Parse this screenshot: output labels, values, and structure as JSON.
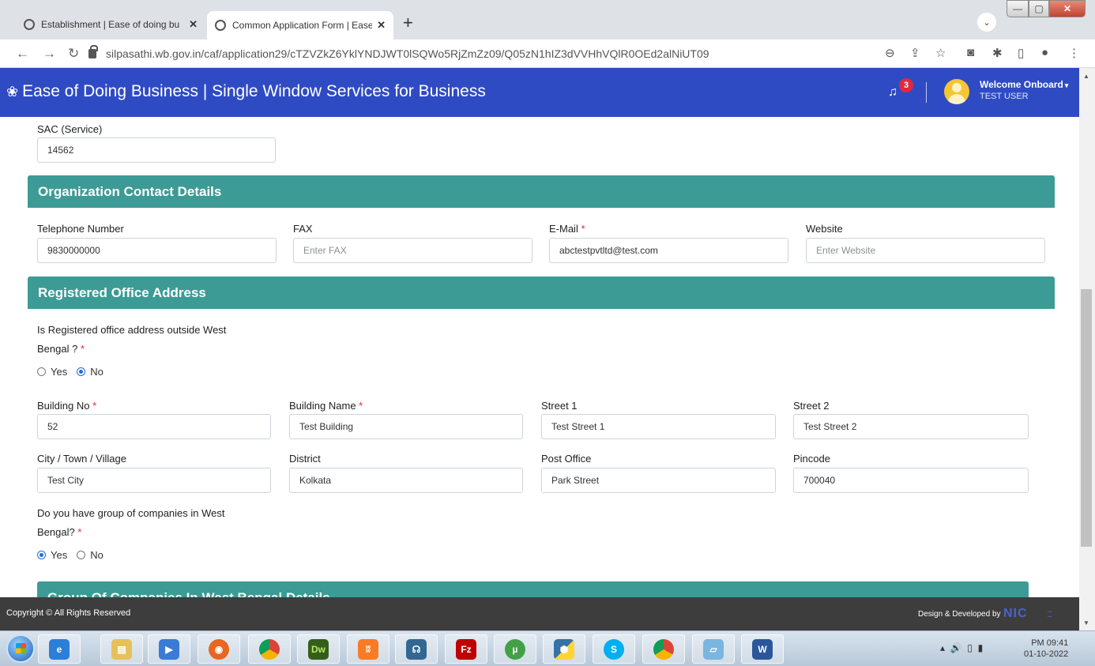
{
  "browser": {
    "tabs": [
      {
        "title": "Establishment | Ease of doing bu",
        "active": false
      },
      {
        "title": "Common Application Form | Ease",
        "active": true
      }
    ],
    "url": "silpasathi.wb.gov.in/caf/application29/cTZVZkZ6YklYNDJWT0lSQWo5RjZmZz09/Q05zN1hIZ3dVVHhVQlR0OEd2alNiUT09"
  },
  "header": {
    "title": "Ease of Doing Business | Single Window Services for Business",
    "notification_count": "3",
    "welcome": "Welcome Onboard",
    "user": "TEST USER"
  },
  "sac": {
    "label": "SAC (Service)",
    "value": "14562"
  },
  "contact": {
    "heading": "Organization Contact Details",
    "telephone_label": "Telephone Number",
    "telephone_value": "9830000000",
    "fax_label": "FAX",
    "fax_placeholder": "Enter FAX",
    "email_label": "E-Mail",
    "email_value": "abctestpvtltd@test.com",
    "website_label": "Website",
    "website_placeholder": "Enter Website"
  },
  "registered": {
    "heading": "Registered Office Address",
    "outside_q_line1": "Is Registered office address outside West",
    "outside_q_line2": "Bengal ?",
    "yes": "Yes",
    "no": "No",
    "outside_selected": "No",
    "building_no_label": "Building No",
    "building_no_value": "52",
    "building_name_label": "Building Name",
    "building_name_value": "Test Building",
    "street1_label": "Street 1",
    "street1_value": "Test Street 1",
    "street2_label": "Street 2",
    "street2_value": "Test Street 2",
    "city_label": "City / Town / Village",
    "city_value": "Test City",
    "district_label": "District",
    "district_value": "Kolkata",
    "post_office_label": "Post Office",
    "post_office_value": "Park Street",
    "pincode_label": "Pincode",
    "pincode_value": "700040",
    "group_q_line1": "Do you have group of companies in West",
    "group_q_line2": "Bengal?",
    "group_selected": "Yes"
  },
  "group_section": {
    "heading": "Group Of Companies In West Bengal Details"
  },
  "footer": {
    "copyright": "Copyright © All Rights Reserved",
    "design": "Design & Developed by",
    "nic": "NIC"
  },
  "taskbar": {
    "time": "PM 09:41",
    "date": "01-10-2022",
    "apps": [
      "internet-explorer",
      "file-explorer",
      "media-player",
      "firefox",
      "chrome",
      "dreamweaver",
      "xampp",
      "postgresql",
      "filezilla",
      "utorrent",
      "python",
      "skype",
      "chrome-2",
      "notepad",
      "word"
    ]
  },
  "colors": {
    "header_blue": "#2f4bc4",
    "section_teal": "#3c9b95",
    "required_red": "#e1283f",
    "footer_dark": "#3d3d3d"
  }
}
